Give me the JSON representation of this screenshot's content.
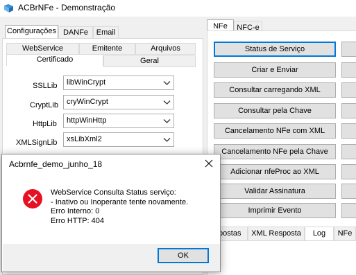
{
  "window": {
    "title": "ACBrNFe - Demonstração"
  },
  "left": {
    "tabs": [
      "Configurações",
      "DANFe",
      "Email"
    ],
    "subtabs_row1": [
      "WebService",
      "Emitente",
      "Arquivos"
    ],
    "subtabs_row2": [
      "Certificado",
      "Geral"
    ],
    "libs": [
      {
        "label": "SSLLib",
        "value": "libWinCrypt"
      },
      {
        "label": "CryptLib",
        "value": "cryWinCrypt"
      },
      {
        "label": "HttpLib",
        "value": "httpWinHttp"
      },
      {
        "label": "XMLSignLib",
        "value": "xsLibXml2"
      }
    ]
  },
  "right": {
    "tabs": [
      "NFe",
      "NFC-e"
    ],
    "buttons": [
      "Status de Serviço",
      "Criar e Enviar",
      "Consultar carregando XML",
      "Consultar pela Chave",
      "Cancelamento NFe com XML",
      "Cancelamento NFe pela Chave",
      "Adicionar nfeProc ao XML",
      "Validar Assinatura",
      "Imprimir Evento"
    ],
    "bottom_tabs": [
      "spostas",
      "XML Resposta",
      "Log",
      "NFe"
    ]
  },
  "dialog": {
    "title": "Acbrnfe_demo_junho_18",
    "message": "WebService Consulta Status serviço:\n- Inativo ou Inoperante tente novamente.\nErro Interno: 0\nErro HTTP: 404",
    "ok_label": "OK"
  },
  "colors": {
    "focus_border": "#0078d7",
    "error_red": "#e81123"
  }
}
